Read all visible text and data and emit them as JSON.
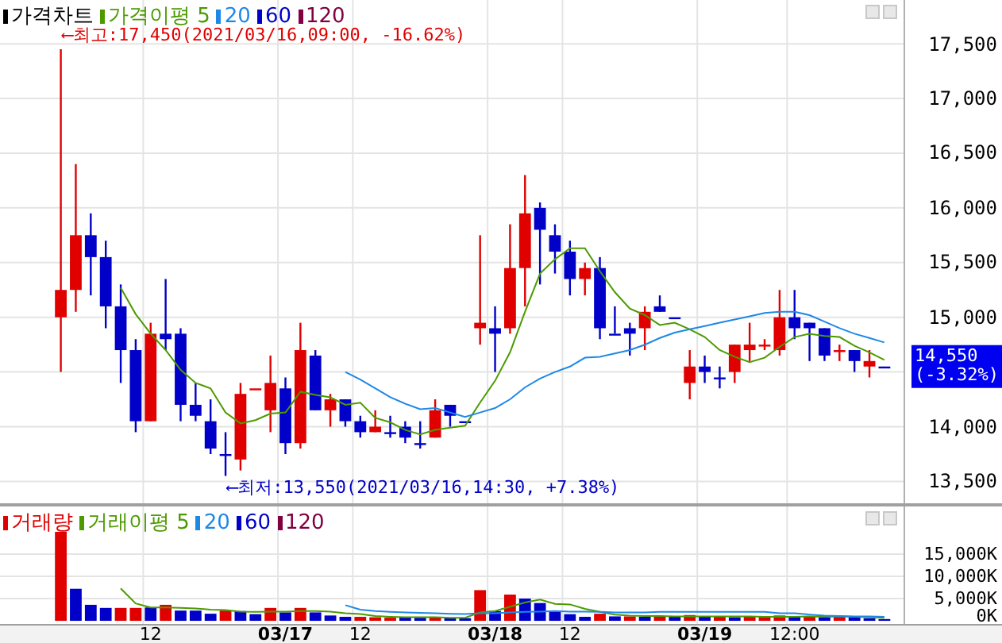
{
  "price_chart": {
    "chart_data": {
      "type": "candlestick",
      "title": "가격차트",
      "grid": true,
      "legend": "upper left",
      "categories": [
        null,
        null,
        null,
        null,
        null,
        null,
        null,
        null,
        null,
        null,
        null,
        null,
        null,
        null,
        null,
        null,
        null,
        null,
        null,
        null,
        null,
        null,
        null,
        null,
        null,
        null,
        null,
        null,
        null,
        null,
        null,
        null,
        null,
        null,
        null,
        null,
        null,
        null,
        null,
        null,
        null,
        null,
        null,
        null,
        null,
        null,
        null,
        null,
        null,
        null,
        null,
        null,
        null,
        null,
        null,
        null
      ],
      "ylim": [
        13300,
        17900
      ],
      "ohlc": [
        [
          15000,
          17450,
          14500,
          15250
        ],
        [
          15250,
          16400,
          15050,
          15750
        ],
        [
          15750,
          15950,
          15200,
          15550
        ],
        [
          15550,
          15700,
          14900,
          15100
        ],
        [
          15100,
          15300,
          14400,
          14700
        ],
        [
          14700,
          14800,
          13950,
          14050
        ],
        [
          14050,
          14950,
          14050,
          14850
        ],
        [
          14850,
          15350,
          14700,
          14800
        ],
        [
          14850,
          14900,
          14050,
          14200
        ],
        [
          14200,
          14400,
          14050,
          14100
        ],
        [
          14050,
          14250,
          13750,
          13800
        ],
        [
          13750,
          13950,
          13550,
          13750
        ],
        [
          13700,
          14400,
          13600,
          14300
        ],
        [
          14350,
          14350,
          14350,
          14350
        ],
        [
          14150,
          14650,
          13950,
          14400
        ],
        [
          14350,
          14450,
          13750,
          13850
        ],
        [
          13850,
          14950,
          13800,
          14700
        ],
        [
          14650,
          14700,
          14150,
          14150
        ],
        [
          14150,
          14300,
          14000,
          14250
        ],
        [
          14250,
          14250,
          14000,
          14050
        ],
        [
          14050,
          14100,
          13900,
          13950
        ],
        [
          13950,
          14150,
          13950,
          14000
        ],
        [
          13950,
          14100,
          13900,
          13950
        ],
        [
          14000,
          14050,
          13850,
          13900
        ],
        [
          13850,
          14050,
          13800,
          13850
        ],
        [
          13900,
          14250,
          13900,
          14150
        ],
        [
          14200,
          14200,
          14000,
          14100
        ],
        [
          14050,
          14050,
          14050,
          14050
        ],
        [
          14900,
          15750,
          14750,
          14950
        ],
        [
          14900,
          15100,
          14500,
          14850
        ],
        [
          14900,
          15850,
          14850,
          15450
        ],
        [
          15450,
          16300,
          15100,
          15950
        ],
        [
          16000,
          16050,
          15300,
          15800
        ],
        [
          15750,
          15850,
          15400,
          15600
        ],
        [
          15600,
          15700,
          15200,
          15350
        ],
        [
          15350,
          15500,
          15200,
          15450
        ],
        [
          15450,
          15550,
          14800,
          14900
        ],
        [
          14850,
          15100,
          14850,
          14850
        ],
        [
          14900,
          14950,
          14650,
          14850
        ],
        [
          14900,
          15100,
          14700,
          15050
        ],
        [
          15100,
          15200,
          15050,
          15050
        ],
        [
          15000,
          15000,
          15000,
          15000
        ],
        [
          14400,
          14700,
          14250,
          14550
        ],
        [
          14550,
          14650,
          14400,
          14500
        ],
        [
          14450,
          14550,
          14350,
          14450
        ],
        [
          14500,
          14750,
          14400,
          14750
        ],
        [
          14700,
          14950,
          14600,
          14750
        ],
        [
          14750,
          14800,
          14700,
          14750
        ],
        [
          14700,
          15250,
          14650,
          15000
        ],
        [
          15000,
          15250,
          14800,
          14900
        ],
        [
          14950,
          14950,
          14600,
          14900
        ],
        [
          14900,
          14900,
          14600,
          14650
        ],
        [
          14700,
          14750,
          14600,
          14700
        ],
        [
          14700,
          14700,
          14500,
          14600
        ],
        [
          14550,
          14700,
          14450,
          14600
        ],
        [
          14550,
          14550,
          14550,
          14550
        ]
      ],
      "series": [
        {
          "name": "가격이평 5",
          "type": "line",
          "color": "#4c9a00",
          "values": [
            null,
            null,
            null,
            null,
            15270,
            15030,
            14850,
            14700,
            14520,
            14400,
            14350,
            14130,
            14030,
            14060,
            14120,
            14130,
            14320,
            14290,
            14270,
            14200,
            14220,
            14080,
            14040,
            13970,
            13930,
            13970,
            13990,
            14010,
            14220,
            14420,
            14680,
            15050,
            15400,
            15530,
            15630,
            15630,
            15420,
            15230,
            15080,
            15020,
            14930,
            14950,
            14890,
            14820,
            14700,
            14640,
            14590,
            14630,
            14730,
            14820,
            14850,
            14830,
            14820,
            14740,
            14680,
            14610
          ]
        },
        {
          "name": "20",
          "type": "line",
          "color": "#1e88e5",
          "values": [
            null,
            null,
            null,
            null,
            null,
            null,
            null,
            null,
            null,
            null,
            null,
            null,
            null,
            null,
            null,
            null,
            null,
            null,
            null,
            14500,
            14430,
            14350,
            14270,
            14210,
            14160,
            14170,
            14130,
            14090,
            14130,
            14170,
            14250,
            14360,
            14440,
            14500,
            14550,
            14630,
            14640,
            14670,
            14700,
            14750,
            14810,
            14860,
            14890,
            14920,
            14950,
            14980,
            15010,
            15040,
            15050,
            15050,
            15020,
            14960,
            14900,
            14850,
            14810,
            14770
          ]
        },
        {
          "name": "60",
          "type": "line",
          "color": "#0000c8",
          "values": [
            null,
            null,
            null,
            null,
            null,
            null,
            null,
            null,
            null,
            null,
            null,
            null,
            null,
            null,
            null,
            null,
            null,
            null,
            null,
            null,
            null,
            null,
            null,
            null,
            null,
            null,
            null,
            null,
            null,
            null,
            null,
            null,
            null,
            null,
            null,
            null,
            null,
            null,
            null,
            null,
            null,
            null,
            null,
            null,
            null,
            null,
            null,
            null,
            null,
            null,
            null,
            null,
            null,
            null,
            null,
            null
          ]
        },
        {
          "name": "120",
          "type": "line",
          "color": "#800040",
          "values": [
            null,
            null,
            null,
            null,
            null,
            null,
            null,
            null,
            null,
            null,
            null,
            null,
            null,
            null,
            null,
            null,
            null,
            null,
            null,
            null,
            null,
            null,
            null,
            null,
            null,
            null,
            null,
            null,
            null,
            null,
            null,
            null,
            null,
            null,
            null,
            null,
            null,
            null,
            null,
            null,
            null,
            null,
            null,
            null,
            null,
            null,
            null,
            null,
            null,
            null,
            null,
            null,
            null,
            null,
            null,
            null
          ]
        }
      ],
      "yticks": [
        {
          "value": 17500,
          "label": "17,500"
        },
        {
          "value": 17000,
          "label": "17,000"
        },
        {
          "value": 16500,
          "label": "16,500"
        },
        {
          "value": 16000,
          "label": "16,000"
        },
        {
          "value": 15500,
          "label": "15,500"
        },
        {
          "value": 15000,
          "label": "15,000"
        },
        {
          "value": 14000,
          "label": "14,000"
        },
        {
          "value": 13500,
          "label": "13,500"
        }
      ],
      "annotations": [
        {
          "text": "⟵최고:17,450(2021/03/16,09:00, -16.62%)"
        },
        {
          "text": "⟵최저:13,550(2021/03/16,14:30, +7.38%)"
        }
      ]
    },
    "last_price": {
      "price": "14,550",
      "change": "(-3.32%)"
    }
  },
  "volume_chart": {
    "chart_data": {
      "type": "bar",
      "grid": true,
      "legend": "upper left",
      "categories": [
        null,
        null,
        null,
        null,
        null,
        null,
        "12",
        null,
        null,
        null,
        null,
        null,
        null,
        null,
        null,
        "03/17",
        null,
        null,
        null,
        null,
        "12",
        null,
        null,
        null,
        null,
        null,
        null,
        null,
        null,
        "03/18",
        null,
        null,
        null,
        null,
        "12",
        null,
        null,
        null,
        null,
        null,
        null,
        null,
        null,
        "03/19",
        null,
        null,
        null,
        null,
        null,
        "12:00",
        null,
        null,
        null,
        null,
        null,
        null
      ],
      "ylim": [
        -700,
        25700
      ],
      "series": [
        {
          "name": "거래량",
          "type": "bar",
          "color": "#e00000",
          "values": [
            20000,
            null,
            null,
            null,
            2900,
            2900,
            null,
            3600,
            null,
            null,
            null,
            2300,
            null,
            null,
            2900,
            null,
            2900,
            null,
            null,
            null,
            900,
            800,
            700,
            null,
            null,
            800,
            null,
            null,
            6900,
            null,
            5900,
            null,
            null,
            null,
            null,
            null,
            1600,
            null,
            1000,
            null,
            1100,
            null,
            1300,
            null,
            900,
            null,
            900,
            800,
            1200,
            null,
            1000,
            null,
            900,
            null,
            null,
            null
          ]
        },
        {
          "type": "bar",
          "color": "#0000c8",
          "values": [
            null,
            7200,
            3600,
            2900,
            null,
            null,
            3000,
            null,
            2300,
            2300,
            1600,
            null,
            2200,
            1500,
            null,
            1900,
            null,
            1900,
            1200,
            900,
            null,
            null,
            null,
            800,
            700,
            null,
            700,
            600,
            null,
            2200,
            null,
            5000,
            4000,
            2200,
            1500,
            900,
            null,
            1000,
            null,
            900,
            null,
            900,
            null,
            1000,
            null,
            800,
            null,
            null,
            null,
            900,
            null,
            800,
            null,
            800,
            600,
            400
          ]
        },
        {
          "name": "거래이평 5",
          "type": "line",
          "color": "#4c9a00",
          "values": [
            null,
            null,
            null,
            null,
            7300,
            3900,
            3000,
            3000,
            2900,
            2800,
            2500,
            2400,
            2100,
            2000,
            2100,
            2100,
            2200,
            2200,
            2100,
            1700,
            1500,
            1100,
            900,
            800,
            800,
            800,
            700,
            700,
            1900,
            2200,
            3200,
            4100,
            4800,
            3800,
            3700,
            2700,
            2000,
            1400,
            1200,
            1100,
            1100,
            1000,
            1000,
            1000,
            1000,
            1000,
            1000,
            900,
            900,
            900,
            1000,
            900,
            1000,
            900,
            800,
            700
          ]
        },
        {
          "name": "20",
          "type": "line",
          "color": "#1e88e5",
          "values": [
            null,
            null,
            null,
            null,
            null,
            null,
            null,
            null,
            null,
            null,
            null,
            null,
            null,
            null,
            null,
            null,
            null,
            null,
            null,
            3500,
            2500,
            2200,
            2000,
            1900,
            1800,
            1700,
            1600,
            1500,
            1700,
            1700,
            1900,
            2000,
            2100,
            2200,
            2100,
            2100,
            2000,
            1900,
            1900,
            1900,
            2000,
            2000,
            2000,
            2000,
            2000,
            2000,
            2000,
            2000,
            1700,
            1700,
            1400,
            1200,
            1100,
            1000,
            1000,
            900
          ]
        },
        {
          "name": "60",
          "type": "line",
          "color": "#0000c8",
          "values": [
            null,
            null,
            null,
            null,
            null,
            null,
            null,
            null,
            null,
            null,
            null,
            null,
            null,
            null,
            null,
            null,
            null,
            null,
            null,
            null,
            null,
            null,
            null,
            null,
            null,
            null,
            null,
            null,
            null,
            null,
            null,
            null,
            null,
            null,
            null,
            null,
            null,
            null,
            null,
            null,
            null,
            null,
            null,
            null,
            null,
            null,
            null,
            null,
            null,
            null,
            null,
            null,
            null,
            null,
            null,
            null
          ]
        },
        {
          "name": "120",
          "type": "line",
          "color": "#800040",
          "values": [
            null,
            null,
            null,
            null,
            null,
            null,
            null,
            null,
            null,
            null,
            null,
            null,
            null,
            null,
            null,
            null,
            null,
            null,
            null,
            null,
            null,
            null,
            null,
            null,
            null,
            null,
            null,
            null,
            null,
            null,
            null,
            null,
            null,
            null,
            null,
            null,
            null,
            null,
            null,
            null,
            null,
            null,
            null,
            null,
            null,
            null,
            null,
            null,
            null,
            null,
            null,
            null,
            null,
            null,
            null,
            null
          ]
        }
      ],
      "yticks": [
        {
          "value": 15000,
          "label": "15,000K"
        },
        {
          "value": 10000,
          "label": "10,000K"
        },
        {
          "value": 5000,
          "label": "5,000K"
        },
        {
          "value": 0,
          "label": "0K"
        }
      ]
    }
  }
}
